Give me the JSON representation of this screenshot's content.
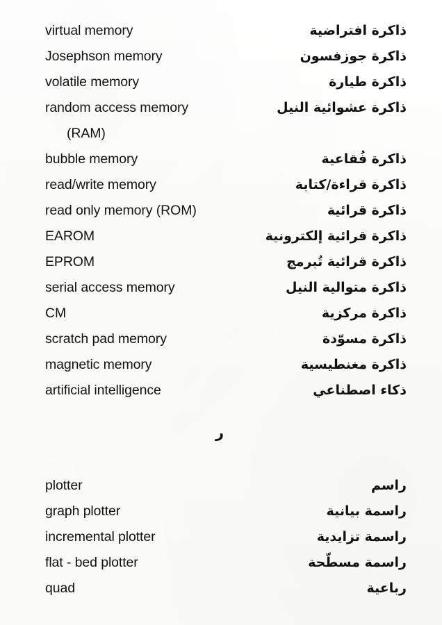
{
  "page": {
    "type": "bilingual-glossary-page",
    "language_left": "English",
    "language_right": "Arabic",
    "background_color": "#fdfdfb",
    "text_color": "#111111"
  },
  "sections": [
    {
      "id": "memory-section",
      "entries": [
        {
          "en": "virtual memory",
          "ar": "ذاكرة افتراضية"
        },
        {
          "en": "Josephson memory",
          "ar": "ذاكرة جوزفسون"
        },
        {
          "en": "volatile memory",
          "ar": "ذاكرة طيارة"
        },
        {
          "en": "random access memory",
          "ar": "ذاكرة عشوائية النيل"
        },
        {
          "en": "(RAM)",
          "ar": "",
          "continuation": true
        },
        {
          "en": "bubble memory",
          "ar": "ذاكرة فُقاعية"
        },
        {
          "en": "read/write memory",
          "ar": "ذاكرة قراءة/كتابة"
        },
        {
          "en": "read only memory (ROM)",
          "ar": "ذاكرة قرائية"
        },
        {
          "en": "EAROM",
          "ar": "ذاكرة قرائية إلكترونية"
        },
        {
          "en": "EPROM",
          "ar": "ذاكرة قرائية تُبرمج"
        },
        {
          "en": "serial access memory",
          "ar": "ذاكرة متوالية النيل"
        },
        {
          "en": "CM",
          "ar": "ذاكرة مركزية"
        },
        {
          "en": "scratch pad memory",
          "ar": "ذاكرة مسوّدة"
        },
        {
          "en": "magnetic memory",
          "ar": "ذاكرة مغنطيسية"
        },
        {
          "en": "artificial intelligence",
          "ar": "ذكاء اصطناعي"
        }
      ]
    }
  ],
  "section_divider": {
    "letter": "ر"
  },
  "sections_after": [
    {
      "id": "plotter-section",
      "entries": [
        {
          "en": "plotter",
          "ar": "راسم"
        },
        {
          "en": "graph plotter",
          "ar": "راسمة بيانية"
        },
        {
          "en": "incremental plotter",
          "ar": "راسمة تزايدية"
        },
        {
          "en": "flat - bed plotter",
          "ar": "راسمة مسطّحة"
        },
        {
          "en": "quad",
          "ar": "رباعية"
        }
      ]
    }
  ]
}
